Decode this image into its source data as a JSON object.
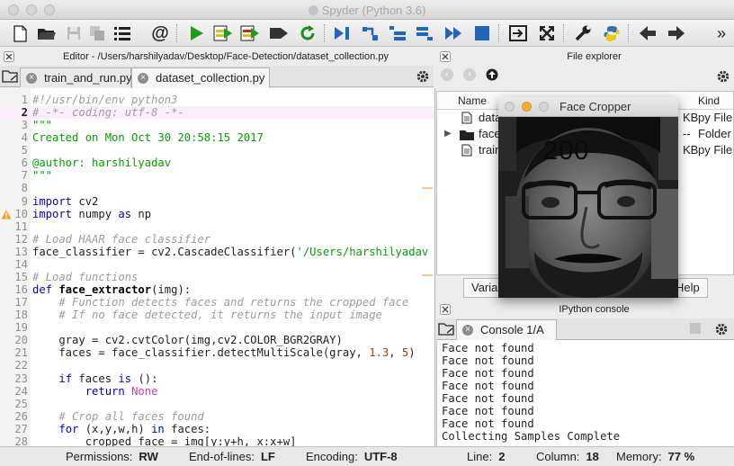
{
  "window": {
    "title": "Spyder (Python 3.6)"
  },
  "toolbar": {
    "buttons": [
      "new-file-icon",
      "open-folder-icon",
      "save-icon",
      "save-all-icon",
      "outline-icon",
      "email-at-icon",
      "run-icon",
      "run-cell-icon",
      "run-cell-advance-icon",
      "run-selection-icon",
      "rerun-icon",
      "debug-icon",
      "step-icon",
      "step-into-icon",
      "step-return-icon",
      "continue-icon",
      "stop-icon",
      "maximize-pane-icon",
      "fullscreen-icon",
      "wrench-icon",
      "python-path-icon",
      "back-arrow-icon",
      "forward-arrow-icon",
      "more-icon"
    ],
    "more_label": "»"
  },
  "editor": {
    "pane_title": "Editor - /Users/harshilyadav/Desktop/Face-Detection/dataset_collection.py",
    "tabs": [
      {
        "label": "train_and_run.py",
        "active": false
      },
      {
        "label": "dataset_collection.py",
        "active": true
      }
    ],
    "current_line": 2,
    "warning_line": 10,
    "lines": [
      {
        "n": "1",
        "seg": [
          {
            "t": "#!/usr/bin/env python3",
            "c": "c-cm"
          }
        ]
      },
      {
        "n": "2",
        "seg": [
          {
            "t": "# -*- coding: utf-8 -*-",
            "c": "c-cm"
          }
        ]
      },
      {
        "n": "3",
        "seg": [
          {
            "t": "\"\"\"",
            "c": "c-st"
          }
        ]
      },
      {
        "n": "4",
        "seg": [
          {
            "t": "Created on Mon Oct 30 20:58:15 2017",
            "c": "c-st"
          }
        ]
      },
      {
        "n": "5",
        "seg": [
          {
            "t": "",
            "c": ""
          }
        ]
      },
      {
        "n": "6",
        "seg": [
          {
            "t": "@author: harshilyadav",
            "c": "c-st"
          }
        ]
      },
      {
        "n": "7",
        "seg": [
          {
            "t": "\"\"\"",
            "c": "c-st"
          }
        ]
      },
      {
        "n": "8",
        "seg": [
          {
            "t": "",
            "c": ""
          }
        ]
      },
      {
        "n": "9",
        "seg": [
          {
            "t": "import",
            "c": "c-kw"
          },
          {
            "t": " cv2",
            "c": ""
          }
        ]
      },
      {
        "n": "10",
        "seg": [
          {
            "t": "import",
            "c": "c-kw"
          },
          {
            "t": " numpy ",
            "c": ""
          },
          {
            "t": "as",
            "c": "c-kw"
          },
          {
            "t": " np",
            "c": ""
          }
        ]
      },
      {
        "n": "11",
        "seg": [
          {
            "t": "",
            "c": ""
          }
        ]
      },
      {
        "n": "12",
        "seg": [
          {
            "t": "# Load HAAR face classifier",
            "c": "c-cm"
          }
        ]
      },
      {
        "n": "13",
        "seg": [
          {
            "t": "face_classifier = cv2.CascadeClassifier(",
            "c": ""
          },
          {
            "t": "'/Users/harshilyadav",
            "c": "c-st"
          }
        ]
      },
      {
        "n": "14",
        "seg": [
          {
            "t": "",
            "c": ""
          }
        ]
      },
      {
        "n": "15",
        "seg": [
          {
            "t": "# Load functions",
            "c": "c-cm"
          }
        ]
      },
      {
        "n": "16",
        "seg": [
          {
            "t": "def",
            "c": "c-kw"
          },
          {
            "t": " ",
            "c": ""
          },
          {
            "t": "face_extractor",
            "c": "c-fn"
          },
          {
            "t": "(img):",
            "c": ""
          }
        ]
      },
      {
        "n": "17",
        "seg": [
          {
            "t": "    # Function detects faces and returns the cropped face",
            "c": "c-cm"
          }
        ]
      },
      {
        "n": "18",
        "seg": [
          {
            "t": "    # If no face detected, it returns the input image",
            "c": "c-cm"
          }
        ]
      },
      {
        "n": "19",
        "seg": [
          {
            "t": "",
            "c": ""
          }
        ]
      },
      {
        "n": "20",
        "seg": [
          {
            "t": "    gray = cv2.cvtColor(img,cv2.COLOR_BGR2GRAY)",
            "c": ""
          }
        ]
      },
      {
        "n": "21",
        "seg": [
          {
            "t": "    faces = face_classifier.detectMultiScale(gray, ",
            "c": ""
          },
          {
            "t": "1.3",
            "c": "c-nm"
          },
          {
            "t": ", ",
            "c": ""
          },
          {
            "t": "5",
            "c": "c-nm"
          },
          {
            "t": ")",
            "c": ""
          }
        ]
      },
      {
        "n": "22",
        "seg": [
          {
            "t": "",
            "c": ""
          }
        ]
      },
      {
        "n": "23",
        "seg": [
          {
            "t": "    ",
            "c": ""
          },
          {
            "t": "if",
            "c": "c-kw"
          },
          {
            "t": " faces ",
            "c": ""
          },
          {
            "t": "is",
            "c": "c-kw"
          },
          {
            "t": " ():",
            "c": ""
          }
        ]
      },
      {
        "n": "24",
        "seg": [
          {
            "t": "        ",
            "c": ""
          },
          {
            "t": "return",
            "c": "c-kw"
          },
          {
            "t": " ",
            "c": ""
          },
          {
            "t": "None",
            "c": "c-pr"
          }
        ]
      },
      {
        "n": "25",
        "seg": [
          {
            "t": "",
            "c": ""
          }
        ]
      },
      {
        "n": "26",
        "seg": [
          {
            "t": "    # Crop all faces found",
            "c": "c-cm"
          }
        ]
      },
      {
        "n": "27",
        "seg": [
          {
            "t": "    ",
            "c": ""
          },
          {
            "t": "for",
            "c": "c-kw"
          },
          {
            "t": " (x,y,w,h) ",
            "c": ""
          },
          {
            "t": "in",
            "c": "c-kw"
          },
          {
            "t": " faces:",
            "c": ""
          }
        ]
      },
      {
        "n": "28",
        "seg": [
          {
            "t": "        cropped_face = img[y:y+h, x:x+w]",
            "c": ""
          }
        ]
      }
    ]
  },
  "file_explorer": {
    "pane_title": "File explorer",
    "columns": [
      "Name",
      "Kind"
    ],
    "rows": [
      {
        "name": "data",
        "size": "KB",
        "kind": "py File",
        "icon": "file-icon",
        "expandable": false
      },
      {
        "name": "face",
        "size": "--",
        "kind": "Folder",
        "icon": "folder-icon",
        "expandable": true
      },
      {
        "name": "train",
        "size": "KB",
        "kind": "py File",
        "icon": "file-icon",
        "expandable": false
      }
    ],
    "bottom_tabs": [
      "Varia",
      "Help"
    ]
  },
  "ipython": {
    "pane_title": "IPython console",
    "tab": "Console 1/A",
    "output": [
      "Face not found",
      "Face not found",
      "Face not found",
      "Face not found",
      "Face not found",
      "Face not found",
      "Face not found",
      "Collecting Samples Complete"
    ]
  },
  "face_cropper": {
    "title": "Face Cropper",
    "count": "200"
  },
  "status": {
    "permissions_label": "Permissions:",
    "permissions": "RW",
    "eol_label": "End-of-lines:",
    "eol": "LF",
    "encoding_label": "Encoding:",
    "encoding": "UTF-8",
    "line_label": "Line:",
    "line": "2",
    "column_label": "Column:",
    "column": "18",
    "memory_label": "Memory:",
    "memory": "77 %"
  }
}
